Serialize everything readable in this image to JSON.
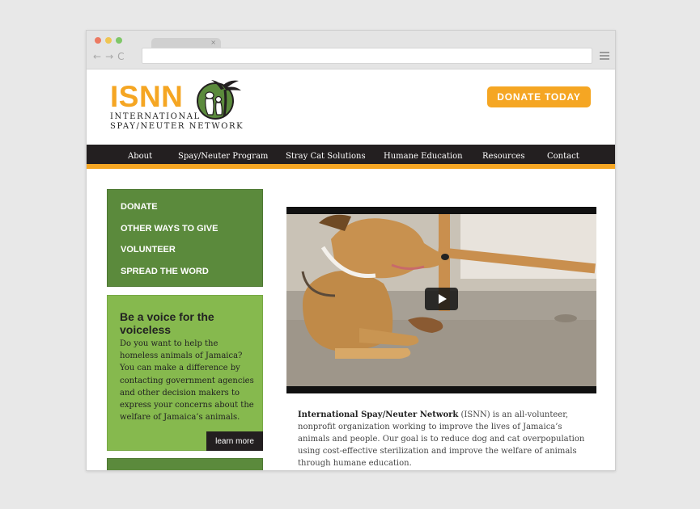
{
  "browser": {
    "tab_close": "×",
    "nav_back": "←",
    "nav_forward": "→",
    "nav_reload": "C"
  },
  "header": {
    "logo_text": "ISNN",
    "logo_line1": "INTERNATIONAL",
    "logo_line2": "SPAY/NEUTER NETWORK",
    "donate_label": "DONATE TODAY"
  },
  "nav": {
    "items": [
      "About",
      "Spay/Neuter Program",
      "Stray Cat Solutions",
      "Humane Education",
      "Resources",
      "Contact"
    ]
  },
  "sidebar": {
    "menu": [
      "DONATE",
      "OTHER WAYS TO GIVE",
      "VOLUNTEER",
      "SPREAD THE WORD"
    ],
    "voice_title": "Be a voice for the voiceless",
    "voice_body": "Do you want to help the homeless animals of Jamaica? You can make a difference by contacting government agencies and other decision makers to express your concerns about the welfare of Jamaica’s animals.",
    "learn_more": "learn more"
  },
  "description": {
    "org_name": "International Spay/Neuter Network",
    "text": " (ISNN) is an all-volunteer, nonprofit organization working to improve the lives of Jamaica’s animals and people. Our goal is to reduce dog and cat overpopulation using cost-effective sterilization and improve the welfare of animals through humane education."
  },
  "colors": {
    "accent_orange": "#f5a623",
    "nav_dark": "#231f20",
    "sidebar_green": "#5b8a3c",
    "panel_green": "#86b94e"
  }
}
